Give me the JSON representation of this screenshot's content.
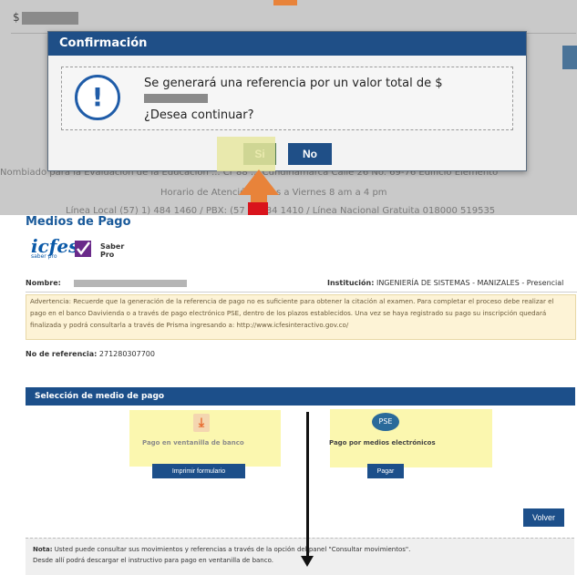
{
  "top": {
    "currency_prefix": "$",
    "footer_line1": "Nombiado para la Evaluación de la Educación ... Cr 88 ... Cundinamarca  Calle 26 No. 69-76  Edificio Elemento",
    "footer_line2": "Horario de Atención Lunes a Viernes 8 am a 4 pm",
    "footer_line3": "Línea Local (57) 1) 484 1460   /   PBX: (57 1) 484 1410   /   Línea Nacional Gratuita 018000 519535"
  },
  "modal": {
    "title": "Confirmación",
    "message": "Se generará una referencia por un valor total de $",
    "question": "¿Desea continuar?",
    "yes_label": "Si",
    "no_label": "No"
  },
  "page": {
    "section_title": "Medios de Pago",
    "logo_text": "icfes",
    "logo_sub": "saber pro",
    "product": "Saber Pro",
    "name_label": "Nombre:",
    "institution_label": "Institución:",
    "institution_value": "INGENIERÍA DE SISTEMAS - MANIZALES - Presencial",
    "warning": "Advertencia: Recuerde que la generación de la referencia de pago no es suficiente para obtener la citación al examen. Para completar el proceso debe realizar el pago en el banco Davivienda o a través de pago electrónico PSE, dentro de los plazos establecidos. Una vez se haya registrado su pago su inscripción quedará finalizada y podrá consultarla a través de Prisma ingresando a: http://www.icfesinteractivo.gov.co/",
    "ref_label": "No de referencia:",
    "ref_value": "271280307700",
    "selection_title": "Selección de medio de pago",
    "option_bank": "Pago en ventanilla de banco",
    "option_electronic": "Pago por medios electrónicos",
    "print_button": "Imprimir formulario",
    "pay_button": "Pagar",
    "pse_text": "PSE",
    "back_button": "Volver",
    "note_label": "Nota:",
    "note_line1": " Usted puede consultar sus movimientos y referencias a través de la opción del panel \"Consultar movimientos\".",
    "note_line2": "Desde allí podrá descargar el instructivo para pago en ventanilla de banco."
  }
}
